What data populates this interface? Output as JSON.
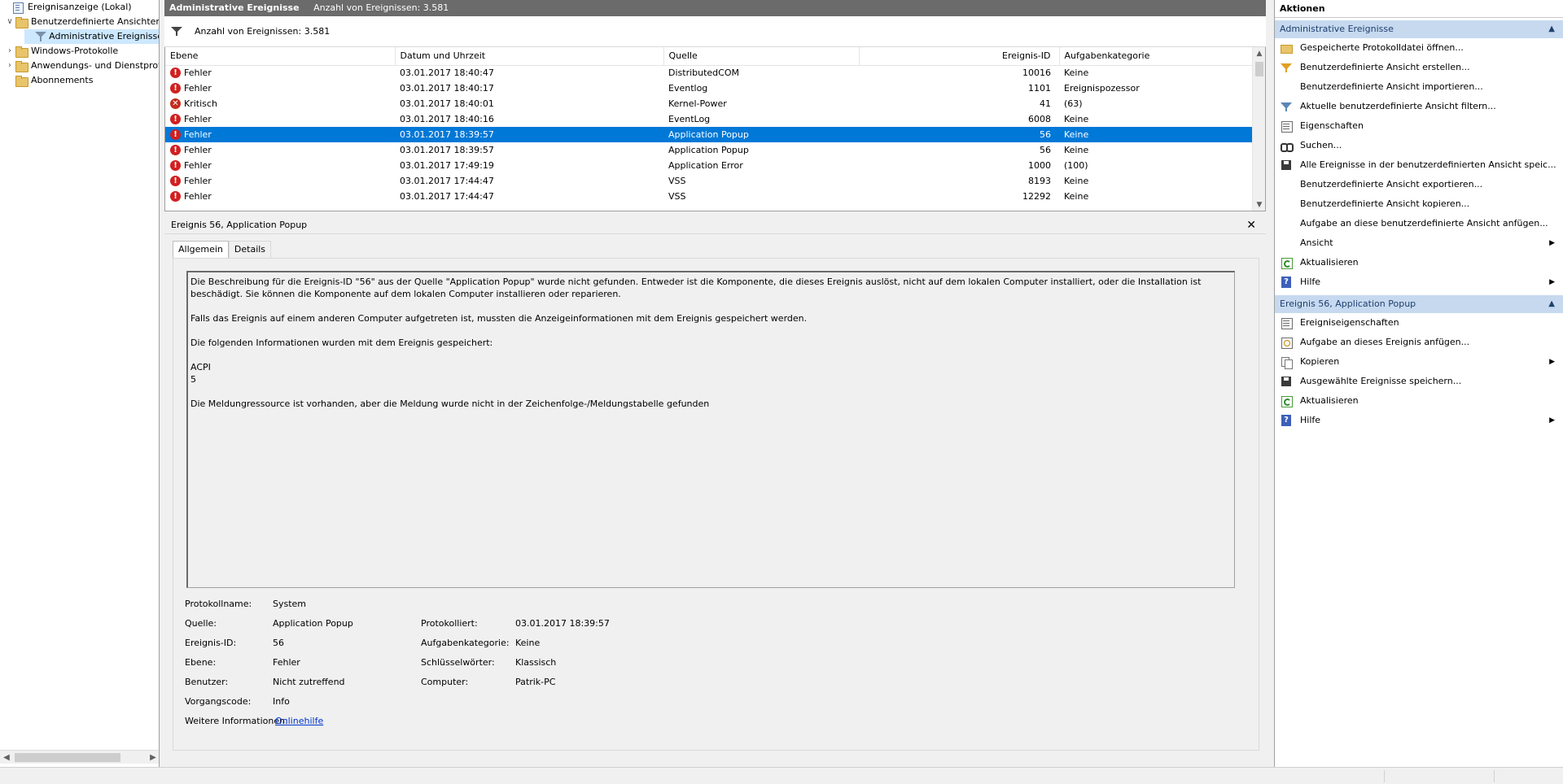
{
  "tree": {
    "items": [
      {
        "label": "Ereignisanzeige (Lokal)",
        "expander": "",
        "icon": "event-viewer-icon"
      },
      {
        "label": "Benutzerdefinierte Ansichten",
        "expander": "∨",
        "icon": "folder-icon"
      },
      {
        "label": "Administrative Ereignisse",
        "expander": "",
        "icon": "filter-icon"
      },
      {
        "label": "Windows-Protokolle",
        "expander": "›",
        "icon": "folder-icon"
      },
      {
        "label": "Anwendungs- und Dienstprotokolle",
        "expander": "›",
        "icon": "folder-icon"
      },
      {
        "label": "Abonnements",
        "expander": "",
        "icon": "folder-icon"
      }
    ]
  },
  "header": {
    "title": "Administrative Ereignisse",
    "count_label": "Anzahl von Ereignissen: 3.581"
  },
  "filterbar": {
    "text": "Anzahl von Ereignissen: 3.581",
    "icon": "filter-icon"
  },
  "grid": {
    "columns": [
      "Ebene",
      "Datum und Uhrzeit",
      "Quelle",
      "Ereignis-ID",
      "Aufgabenkategorie"
    ],
    "rows": [
      {
        "level": "Fehler",
        "icon": "error-icon",
        "date": "03.01.2017 18:40:47",
        "source": "DistributedCOM",
        "id": "10016",
        "category": "Keine"
      },
      {
        "level": "Fehler",
        "icon": "error-icon",
        "date": "03.01.2017 18:40:17",
        "source": "Eventlog",
        "id": "1101",
        "category": "Ereignispozessor"
      },
      {
        "level": "Kritisch",
        "icon": "critical-icon",
        "date": "03.01.2017 18:40:01",
        "source": "Kernel-Power",
        "id": "41",
        "category": "(63)"
      },
      {
        "level": "Fehler",
        "icon": "error-icon",
        "date": "03.01.2017 18:40:16",
        "source": "EventLog",
        "id": "6008",
        "category": "Keine"
      },
      {
        "level": "Fehler",
        "icon": "error-icon",
        "date": "03.01.2017 18:39:57",
        "source": "Application Popup",
        "id": "56",
        "category": "Keine",
        "selected": true
      },
      {
        "level": "Fehler",
        "icon": "error-icon",
        "date": "03.01.2017 18:39:57",
        "source": "Application Popup",
        "id": "56",
        "category": "Keine"
      },
      {
        "level": "Fehler",
        "icon": "error-icon",
        "date": "03.01.2017 17:49:19",
        "source": "Application Error",
        "id": "1000",
        "category": "(100)"
      },
      {
        "level": "Fehler",
        "icon": "error-icon",
        "date": "03.01.2017 17:44:47",
        "source": "VSS",
        "id": "8193",
        "category": "Keine"
      },
      {
        "level": "Fehler",
        "icon": "error-icon",
        "date": "03.01.2017 17:44:47",
        "source": "VSS",
        "id": "12292",
        "category": "Keine"
      }
    ]
  },
  "detail": {
    "title": "Ereignis 56, Application Popup",
    "tabs": [
      "Allgemein",
      "Details"
    ],
    "description": [
      "Die Beschreibung für die Ereignis-ID \"56\" aus der Quelle \"Application Popup\" wurde nicht gefunden. Entweder ist die Komponente, die dieses Ereignis auslöst, nicht auf dem lokalen Computer installiert, oder die Installation ist beschädigt. Sie können die Komponente auf dem lokalen Computer installieren oder reparieren.",
      "Falls das Ereignis auf einem anderen Computer aufgetreten ist, mussten die Anzeigeinformationen mit dem Ereignis gespeichert werden.",
      "Die folgenden Informationen wurden mit dem Ereignis gespeichert:",
      "ACPI",
      "5",
      "Die Meldungressource ist vorhanden, aber die Meldung wurde nicht in der Zeichenfolge-/Meldungstabelle gefunden"
    ],
    "props": {
      "log_label": "Protokollname:",
      "log_value": "System",
      "source_label": "Quelle:",
      "source_value": "Application Popup",
      "logged_label": "Protokolliert:",
      "logged_value": "03.01.2017 18:39:57",
      "id_label": "Ereignis-ID:",
      "id_value": "56",
      "task_label": "Aufgabenkategorie:",
      "task_value": "Keine",
      "level_label": "Ebene:",
      "level_value": "Fehler",
      "keywords_label": "Schlüsselwörter:",
      "keywords_value": "Klassisch",
      "user_label": "Benutzer:",
      "user_value": "Nicht zutreffend",
      "computer_label": "Computer:",
      "computer_value": "Patrik-PC",
      "opcode_label": "Vorgangscode:",
      "opcode_value": "Info",
      "more_label": "Weitere Informationen:",
      "more_link": "Onlinehilfe"
    }
  },
  "actions": {
    "title": "Aktionen",
    "section1": {
      "header": "Administrative Ereignisse",
      "items": [
        {
          "label": "Gespeicherte Protokolldatei öffnen...",
          "icon": "open-icon"
        },
        {
          "label": "Benutzerdefinierte Ansicht erstellen...",
          "icon": "create-filter-icon"
        },
        {
          "label": "Benutzerdefinierte Ansicht importieren...",
          "icon": ""
        },
        {
          "label": "Aktuelle benutzerdefinierte Ansicht filtern...",
          "icon": "filter-icon"
        },
        {
          "label": "Eigenschaften",
          "icon": "properties-icon"
        },
        {
          "label": "Suchen...",
          "icon": "binoculars-icon"
        },
        {
          "label": "Alle Ereignisse in der benutzerdefinierten Ansicht speic...",
          "icon": "save-icon"
        },
        {
          "label": "Benutzerdefinierte Ansicht exportieren...",
          "icon": ""
        },
        {
          "label": "Benutzerdefinierte Ansicht kopieren...",
          "icon": ""
        },
        {
          "label": "Aufgabe an diese benutzerdefinierte Ansicht anfügen...",
          "icon": ""
        },
        {
          "label": "Ansicht",
          "icon": "",
          "submenu": true
        },
        {
          "label": "Aktualisieren",
          "icon": "refresh-icon"
        },
        {
          "label": "Hilfe",
          "icon": "help-icon",
          "submenu": true
        }
      ]
    },
    "section2": {
      "header": "Ereignis 56, Application Popup",
      "items": [
        {
          "label": "Ereigniseigenschaften",
          "icon": "properties-icon"
        },
        {
          "label": "Aufgabe an dieses Ereignis anfügen...",
          "icon": "task-icon"
        },
        {
          "label": "Kopieren",
          "icon": "copy-icon",
          "submenu": true
        },
        {
          "label": "Ausgewählte Ereignisse speichern...",
          "icon": "save-icon"
        },
        {
          "label": "Aktualisieren",
          "icon": "refresh-icon"
        },
        {
          "label": "Hilfe",
          "icon": "help-icon",
          "submenu": true
        }
      ]
    }
  },
  "colors": {
    "selection": "#0078d7",
    "section_header": "#c6d9ef",
    "title_bar": "#6b6b6b",
    "error": "#d21f1f"
  }
}
